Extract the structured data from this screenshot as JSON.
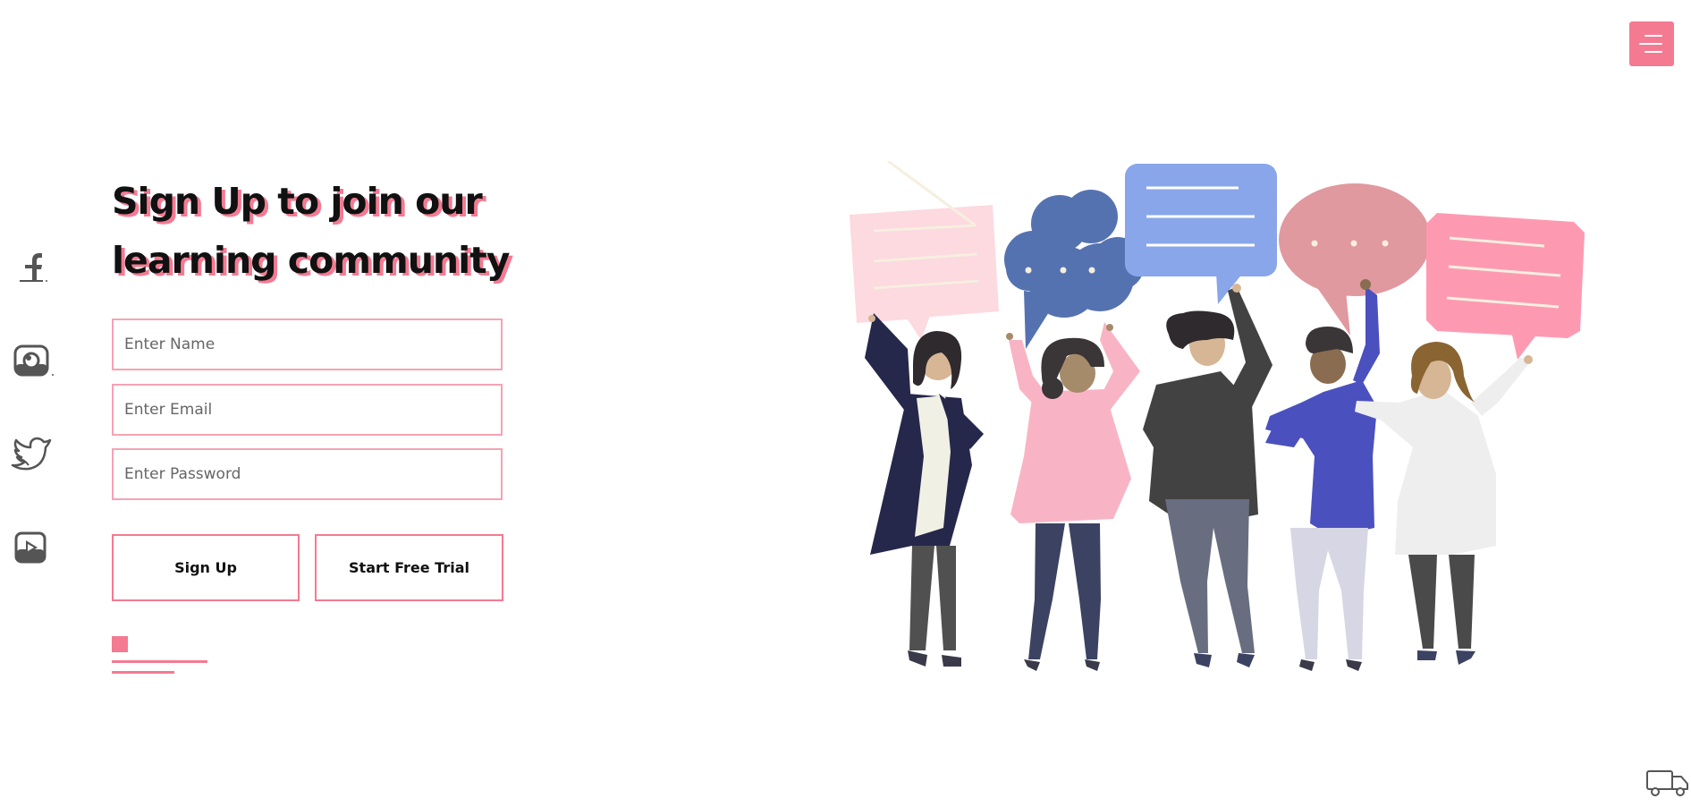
{
  "menu": {
    "icon": "hamburger-menu-icon",
    "color": "#f47a92"
  },
  "social": [
    {
      "name": "facebook-icon"
    },
    {
      "name": "instagram-icon"
    },
    {
      "name": "twitter-icon"
    },
    {
      "name": "youtube-icon"
    }
  ],
  "hero": {
    "heading_line1": "Sign Up to join our",
    "heading_line2": "learning community"
  },
  "form": {
    "name_placeholder": "Enter Name",
    "email_placeholder": "Enter Email",
    "password_placeholder": "Enter Password",
    "name_value": "",
    "email_value": "",
    "password_value": ""
  },
  "buttons": {
    "signup_label": "Sign Up",
    "trial_label": "Start Free Trial"
  },
  "illustration": {
    "name": "people-with-speech-bubbles-illustration"
  },
  "footer": {
    "icon": "delivery-truck-icon"
  },
  "colors": {
    "accent": "#f47a92",
    "accent_light": "#f5a3b5",
    "text": "#111111"
  }
}
